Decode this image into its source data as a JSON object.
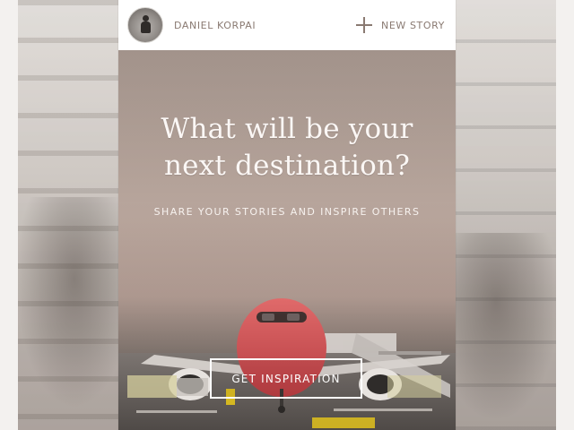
{
  "header": {
    "user_name": "DANIEL KORPAI",
    "new_story_label": "NEW STORY"
  },
  "hero": {
    "title": "What will be your next destination?",
    "subtitle": "SHARE YOUR STORIES AND INSPIRE OTHERS",
    "cta_label": "GET INSPIRATION"
  },
  "icons": {
    "plus": "plus-icon",
    "avatar": "avatar"
  },
  "colors": {
    "header_text": "#8a7a72",
    "white": "#ffffff"
  }
}
